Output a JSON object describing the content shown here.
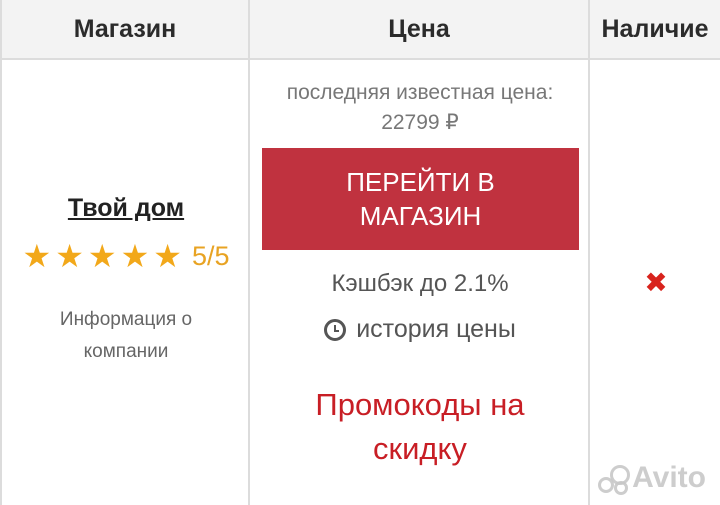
{
  "headers": {
    "shop": "Магазин",
    "price": "Цена",
    "availability": "Наличие"
  },
  "shop": {
    "name": "Твой дом",
    "rating_value": 5,
    "rating_text": "5/5",
    "info_link": "Информация о компании"
  },
  "price": {
    "last_label": "последняя известная цена:",
    "last_value": "22799 ₽",
    "go_button": "ПЕРЕЙТИ В МАГАЗИН",
    "cashback": "Кэшбэк до 2.1%",
    "history": "история цены",
    "promo": "Промокоды на скидку"
  },
  "availability": {
    "status_icon": "cross-icon",
    "in_stock": false
  },
  "watermark": {
    "text": "Avito"
  },
  "colors": {
    "button": "#c0323f",
    "star": "#f2a81a",
    "promo": "#c81e25",
    "cross": "#d8231d"
  }
}
